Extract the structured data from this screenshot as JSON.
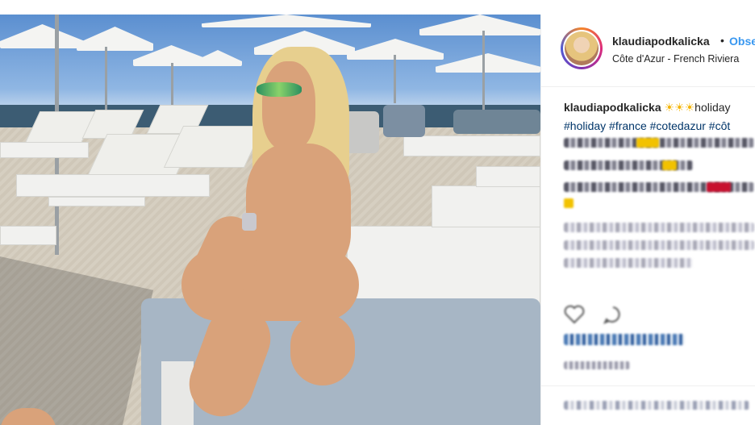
{
  "post": {
    "username": "klaudiapodkalicka",
    "follow_label": "Obse",
    "separator": "•",
    "location": "Côte d'Azur - French Riviera",
    "caption": {
      "username": "klaudiapodkalicka",
      "emoji": "☀☀☀",
      "text": "holiday",
      "hashtags": "#holiday #france #cotedazur #côt"
    }
  },
  "icons": {
    "heart": "heart-icon",
    "comment": "comment-icon",
    "avatar": "avatar"
  },
  "colors": {
    "link_blue": "#3897f0",
    "hashtag_blue": "#003569",
    "text": "#262626",
    "divider": "#efefef"
  }
}
